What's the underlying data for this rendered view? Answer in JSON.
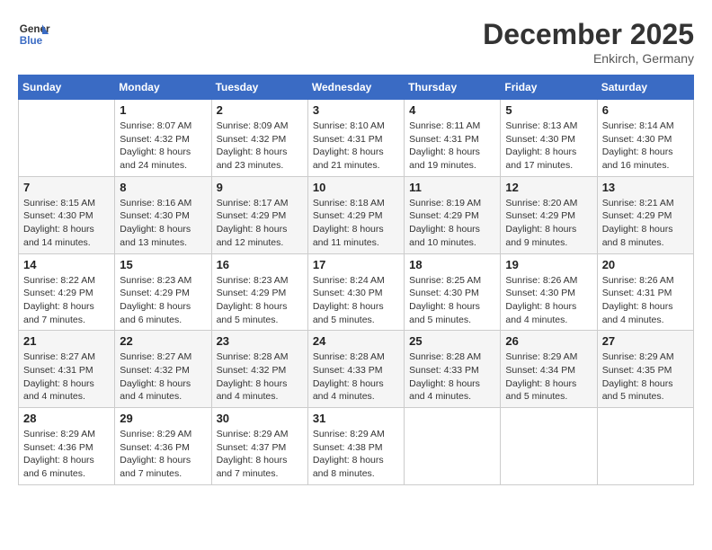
{
  "header": {
    "logo_line1": "General",
    "logo_line2": "Blue",
    "month": "December 2025",
    "location": "Enkirch, Germany"
  },
  "weekdays": [
    "Sunday",
    "Monday",
    "Tuesday",
    "Wednesday",
    "Thursday",
    "Friday",
    "Saturday"
  ],
  "weeks": [
    [
      {
        "day": "",
        "info": ""
      },
      {
        "day": "1",
        "info": "Sunrise: 8:07 AM\nSunset: 4:32 PM\nDaylight: 8 hours\nand 24 minutes."
      },
      {
        "day": "2",
        "info": "Sunrise: 8:09 AM\nSunset: 4:32 PM\nDaylight: 8 hours\nand 23 minutes."
      },
      {
        "day": "3",
        "info": "Sunrise: 8:10 AM\nSunset: 4:31 PM\nDaylight: 8 hours\nand 21 minutes."
      },
      {
        "day": "4",
        "info": "Sunrise: 8:11 AM\nSunset: 4:31 PM\nDaylight: 8 hours\nand 19 minutes."
      },
      {
        "day": "5",
        "info": "Sunrise: 8:13 AM\nSunset: 4:30 PM\nDaylight: 8 hours\nand 17 minutes."
      },
      {
        "day": "6",
        "info": "Sunrise: 8:14 AM\nSunset: 4:30 PM\nDaylight: 8 hours\nand 16 minutes."
      }
    ],
    [
      {
        "day": "7",
        "info": "Sunrise: 8:15 AM\nSunset: 4:30 PM\nDaylight: 8 hours\nand 14 minutes."
      },
      {
        "day": "8",
        "info": "Sunrise: 8:16 AM\nSunset: 4:30 PM\nDaylight: 8 hours\nand 13 minutes."
      },
      {
        "day": "9",
        "info": "Sunrise: 8:17 AM\nSunset: 4:29 PM\nDaylight: 8 hours\nand 12 minutes."
      },
      {
        "day": "10",
        "info": "Sunrise: 8:18 AM\nSunset: 4:29 PM\nDaylight: 8 hours\nand 11 minutes."
      },
      {
        "day": "11",
        "info": "Sunrise: 8:19 AM\nSunset: 4:29 PM\nDaylight: 8 hours\nand 10 minutes."
      },
      {
        "day": "12",
        "info": "Sunrise: 8:20 AM\nSunset: 4:29 PM\nDaylight: 8 hours\nand 9 minutes."
      },
      {
        "day": "13",
        "info": "Sunrise: 8:21 AM\nSunset: 4:29 PM\nDaylight: 8 hours\nand 8 minutes."
      }
    ],
    [
      {
        "day": "14",
        "info": "Sunrise: 8:22 AM\nSunset: 4:29 PM\nDaylight: 8 hours\nand 7 minutes."
      },
      {
        "day": "15",
        "info": "Sunrise: 8:23 AM\nSunset: 4:29 PM\nDaylight: 8 hours\nand 6 minutes."
      },
      {
        "day": "16",
        "info": "Sunrise: 8:23 AM\nSunset: 4:29 PM\nDaylight: 8 hours\nand 5 minutes."
      },
      {
        "day": "17",
        "info": "Sunrise: 8:24 AM\nSunset: 4:30 PM\nDaylight: 8 hours\nand 5 minutes."
      },
      {
        "day": "18",
        "info": "Sunrise: 8:25 AM\nSunset: 4:30 PM\nDaylight: 8 hours\nand 5 minutes."
      },
      {
        "day": "19",
        "info": "Sunrise: 8:26 AM\nSunset: 4:30 PM\nDaylight: 8 hours\nand 4 minutes."
      },
      {
        "day": "20",
        "info": "Sunrise: 8:26 AM\nSunset: 4:31 PM\nDaylight: 8 hours\nand 4 minutes."
      }
    ],
    [
      {
        "day": "21",
        "info": "Sunrise: 8:27 AM\nSunset: 4:31 PM\nDaylight: 8 hours\nand 4 minutes."
      },
      {
        "day": "22",
        "info": "Sunrise: 8:27 AM\nSunset: 4:32 PM\nDaylight: 8 hours\nand 4 minutes."
      },
      {
        "day": "23",
        "info": "Sunrise: 8:28 AM\nSunset: 4:32 PM\nDaylight: 8 hours\nand 4 minutes."
      },
      {
        "day": "24",
        "info": "Sunrise: 8:28 AM\nSunset: 4:33 PM\nDaylight: 8 hours\nand 4 minutes."
      },
      {
        "day": "25",
        "info": "Sunrise: 8:28 AM\nSunset: 4:33 PM\nDaylight: 8 hours\nand 4 minutes."
      },
      {
        "day": "26",
        "info": "Sunrise: 8:29 AM\nSunset: 4:34 PM\nDaylight: 8 hours\nand 5 minutes."
      },
      {
        "day": "27",
        "info": "Sunrise: 8:29 AM\nSunset: 4:35 PM\nDaylight: 8 hours\nand 5 minutes."
      }
    ],
    [
      {
        "day": "28",
        "info": "Sunrise: 8:29 AM\nSunset: 4:36 PM\nDaylight: 8 hours\nand 6 minutes."
      },
      {
        "day": "29",
        "info": "Sunrise: 8:29 AM\nSunset: 4:36 PM\nDaylight: 8 hours\nand 7 minutes."
      },
      {
        "day": "30",
        "info": "Sunrise: 8:29 AM\nSunset: 4:37 PM\nDaylight: 8 hours\nand 7 minutes."
      },
      {
        "day": "31",
        "info": "Sunrise: 8:29 AM\nSunset: 4:38 PM\nDaylight: 8 hours\nand 8 minutes."
      },
      {
        "day": "",
        "info": ""
      },
      {
        "day": "",
        "info": ""
      },
      {
        "day": "",
        "info": ""
      }
    ]
  ]
}
